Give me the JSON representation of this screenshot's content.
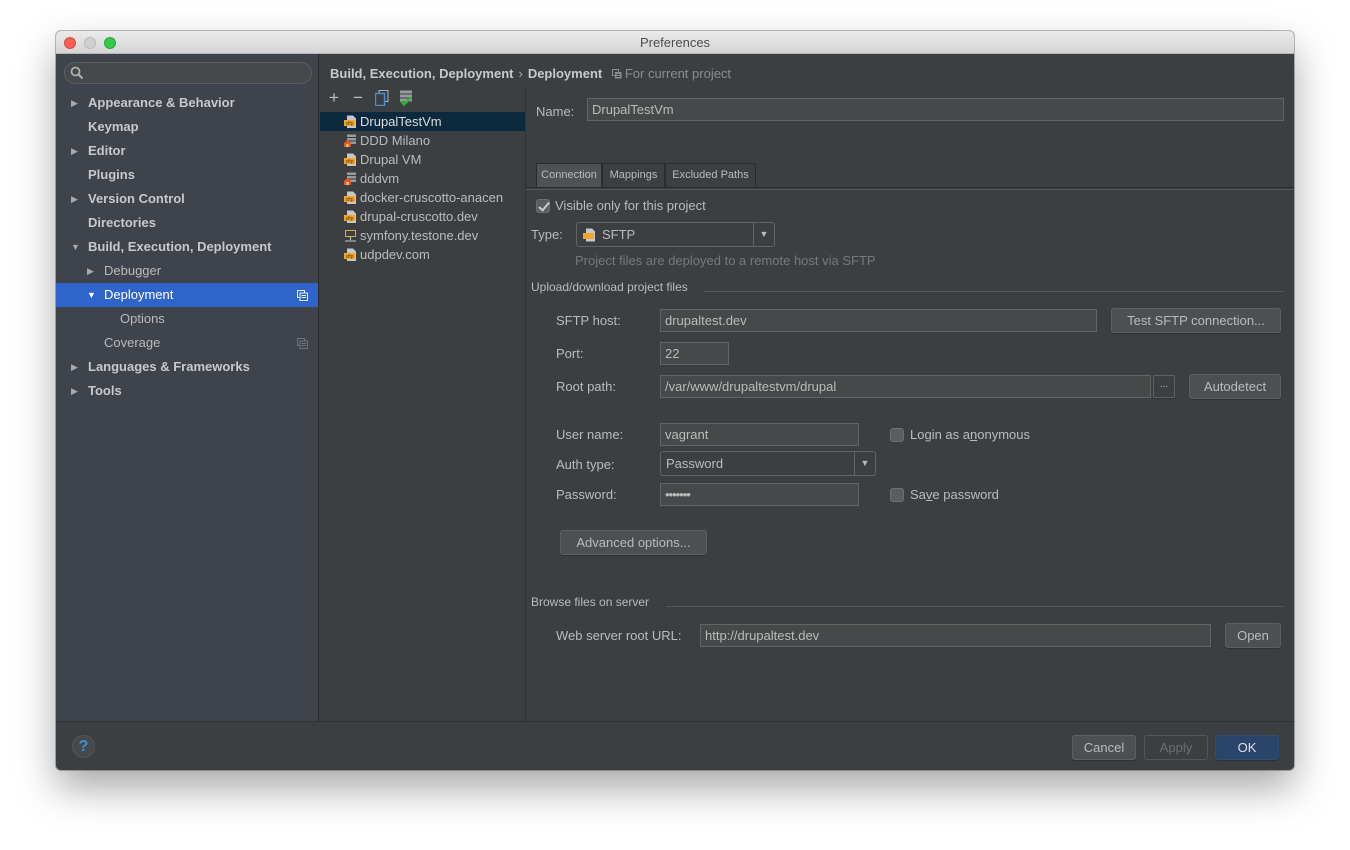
{
  "window": {
    "title": "Preferences"
  },
  "sidebar": {
    "search": {
      "value": "",
      "placeholder": "",
      "icon": "search-icon"
    },
    "items": [
      {
        "label": "Appearance & Behavior",
        "level": 0,
        "expandable": true,
        "expanded": false,
        "bold": true
      },
      {
        "label": "Keymap",
        "level": 0,
        "expandable": false,
        "bold": true
      },
      {
        "label": "Editor",
        "level": 0,
        "expandable": true,
        "expanded": false,
        "bold": true
      },
      {
        "label": "Plugins",
        "level": 0,
        "expandable": false,
        "bold": true
      },
      {
        "label": "Version Control",
        "level": 0,
        "expandable": true,
        "expanded": false,
        "bold": true
      },
      {
        "label": "Directories",
        "level": 0,
        "expandable": false,
        "bold": true
      },
      {
        "label": "Build, Execution, Deployment",
        "level": 0,
        "expandable": true,
        "expanded": true,
        "bold": true
      },
      {
        "label": "Debugger",
        "level": 1,
        "expandable": true,
        "expanded": false,
        "bold": false
      },
      {
        "label": "Deployment",
        "level": 1,
        "expandable": true,
        "expanded": true,
        "bold": false,
        "selected": true,
        "project_icon": "project-scope-icon"
      },
      {
        "label": "Options",
        "level": 2,
        "expandable": false,
        "bold": false
      },
      {
        "label": "Coverage",
        "level": 1,
        "expandable": false,
        "bold": false,
        "project_icon": "project-scope-icon"
      },
      {
        "label": "Languages & Frameworks",
        "level": 0,
        "expandable": true,
        "expanded": false,
        "bold": true
      },
      {
        "label": "Tools",
        "level": 0,
        "expandable": true,
        "expanded": false,
        "bold": true
      }
    ]
  },
  "breadcrumb": {
    "parent": "Build, Execution, Deployment",
    "separator": "›",
    "current": "Deployment",
    "scope": "For current project"
  },
  "server_toolbar": {
    "add": "+",
    "remove": "−",
    "copy_icon": "copy-icon",
    "default_icon": "use-as-default-icon"
  },
  "servers": [
    {
      "name": "DrupalTestVm",
      "type": "sftp",
      "selected": true
    },
    {
      "name": "DDD Milano",
      "type": "local"
    },
    {
      "name": "Drupal VM",
      "type": "sftp"
    },
    {
      "name": "dddvm",
      "type": "local"
    },
    {
      "name": "docker-cruscotto-anacen",
      "type": "sftp"
    },
    {
      "name": "drupal-cruscotto.dev",
      "type": "sftp"
    },
    {
      "name": "symfony.testone.dev",
      "type": "mounted"
    },
    {
      "name": "udpdev.com",
      "type": "sftp"
    }
  ],
  "config": {
    "name_label": "Name:",
    "name_value": "DrupalTestVm",
    "tabs": [
      "Connection",
      "Mappings",
      "Excluded Paths"
    ],
    "active_tab": "Connection",
    "visible_only": {
      "label": "Visible only for this project",
      "checked": true
    },
    "type_label": "Type:",
    "type_value": "SFTP",
    "type_hint": "Project files are deployed to a remote host via SFTP",
    "upload_section": "Upload/download project files",
    "sftp_host_label": "SFTP host:",
    "sftp_host_value": "drupaltest.dev",
    "test_button": "Test SFTP connection...",
    "port_label": "Port:",
    "port_value": "22",
    "root_path_label": "Root path:",
    "root_path_value": "/var/www/drupaltestvm/drupal",
    "browse_button": "...",
    "autodetect_button": "Autodetect",
    "user_label": "User name:",
    "user_value": "vagrant",
    "anonymous": {
      "label_pre": "Login as a",
      "label_mnemonic": "n",
      "label_post": "onymous",
      "checked": false
    },
    "auth_label": "Auth type:",
    "auth_value": "Password",
    "password_label": "Password:",
    "password_value": "•••••••",
    "save_password": {
      "label_pre": "Sa",
      "label_mnemonic": "v",
      "label_post": "e password",
      "checked": false
    },
    "advanced_button": "Advanced options...",
    "browse_section": "Browse files on server",
    "web_root_label": "Web server root URL:",
    "web_root_value": "http://drupaltest.dev",
    "open_button": "Open"
  },
  "footer": {
    "help": "?",
    "cancel": "Cancel",
    "apply": "Apply",
    "ok": "OK"
  },
  "colors": {
    "selection": "#2f65ca",
    "list_selection": "#0d293e",
    "ok_button": "#2b446a",
    "help_icon": "#3d8fd1"
  }
}
